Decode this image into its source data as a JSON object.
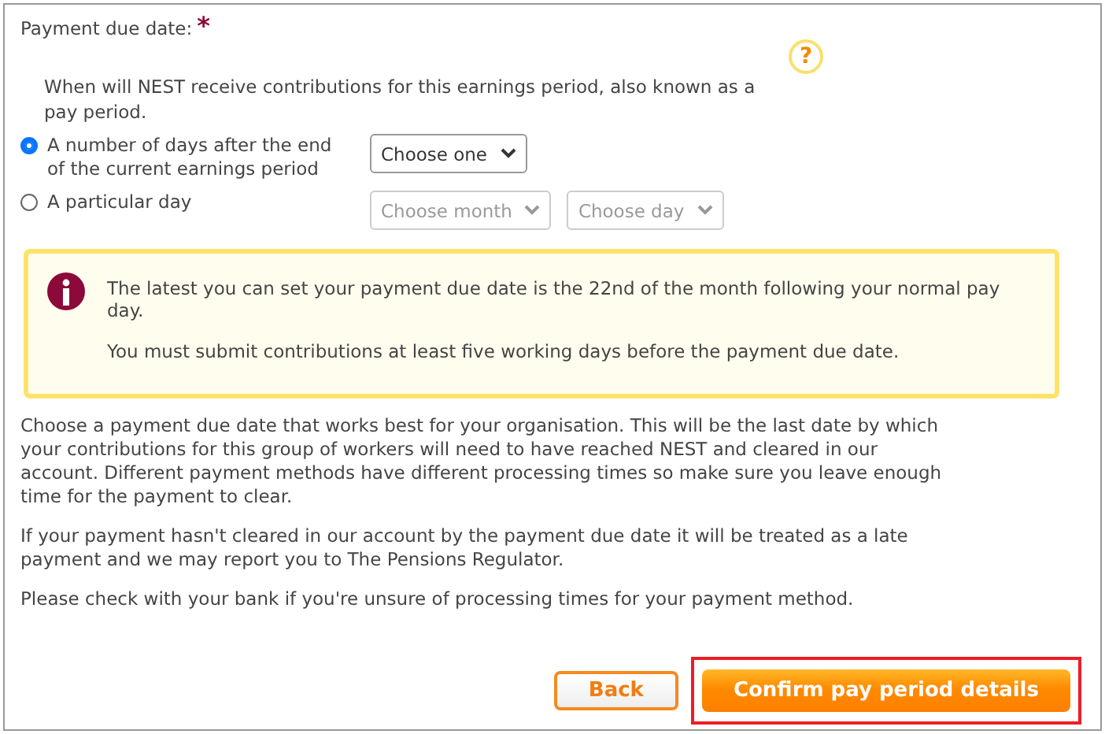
{
  "field_label": "Payment due date:",
  "required_mark": "*",
  "help_icon": "?",
  "description": "When will NEST receive contributions for this earnings period, also known as a pay period.",
  "options": [
    {
      "label": "A number of days after the end of the current earnings period",
      "selected": true,
      "selects": [
        {
          "placeholder": "Choose one",
          "disabled": false
        }
      ]
    },
    {
      "label": "A particular day",
      "selected": false,
      "selects": [
        {
          "placeholder": "Choose month",
          "disabled": true
        },
        {
          "placeholder": "Choose day",
          "disabled": true
        }
      ]
    }
  ],
  "info_box": {
    "lines": [
      "The latest you can set your payment due date is the 22nd of the month following your normal pay day.",
      "You must submit contributions at least five working days before the payment due date."
    ]
  },
  "paragraphs": [
    "Choose a payment due date that works best for your organisation. This will be the last date by which your contributions for this group of workers will need to have reached NEST and cleared in our account. Different payment methods have different processing times so make sure you leave enough time for the payment to clear.",
    "If your payment hasn't cleared in our account by the payment due date it will be treated as a late payment and we may report you to The Pensions Regulator.",
    "Please check with your bank if you're unsure of processing times for your payment method."
  ],
  "buttons": [
    {
      "label": "Back",
      "kind": "secondary",
      "highlighted": false
    },
    {
      "label": "Confirm pay period details",
      "kind": "primary",
      "highlighted": true
    }
  ]
}
